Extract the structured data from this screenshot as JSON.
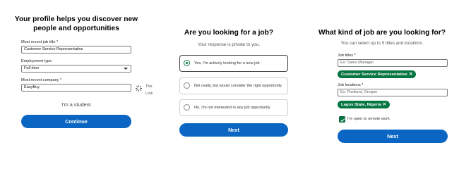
{
  "panel1": {
    "title": "Your profile helps you discover new people and opportunities",
    "job_title_label": "Most recent job title *",
    "job_title_value": "Customer Service Representative",
    "employment_type_label": "Employment type",
    "employment_type_value": "Full-time",
    "company_label": "Most recent company *",
    "company_value": "EasyBuy",
    "side_text_1": "The",
    "side_text_2": "Link",
    "student_link": "I'm a student",
    "continue_button": "Continue"
  },
  "panel2": {
    "title": "Are you looking for a job?",
    "subtitle": "Your response is private to you.",
    "options": [
      {
        "label": "Yes, I'm actively looking for a new job",
        "selected": true
      },
      {
        "label": "Not really, but would consider the right opportunity",
        "selected": false
      },
      {
        "label": "No, I'm not interested in any job opportunity",
        "selected": false
      }
    ],
    "next_button": "Next"
  },
  "panel3": {
    "title": "What kind of job are you looking for?",
    "subtitle": "You can select up to 5 titles and locations.",
    "job_titles_label": "Job titles *",
    "job_titles_placeholder": "Ex: Sales Manager",
    "job_title_pill": "Customer Service Representative",
    "job_locations_label": "Job locations *",
    "job_locations_placeholder": "Ex: Portland, Oregon",
    "location_pill": "Lagos State, Nigeria",
    "remote_label": "I'm open to remote work",
    "remote_checked": true,
    "next_button": "Next"
  },
  "colors": {
    "primary_blue": "#0a66c2",
    "success_green": "#057642"
  }
}
